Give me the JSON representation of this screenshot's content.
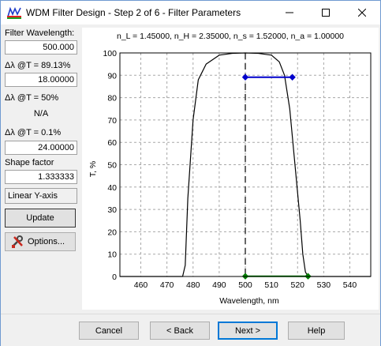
{
  "window": {
    "title": "WDM Filter Design - Step 2 of 6 - Filter Parameters"
  },
  "left_panel": {
    "filter_wavelength_label": "Filter Wavelength:",
    "filter_wavelength_value": "500.000",
    "dl_8913_label": "Δλ @T = 89.13%",
    "dl_8913_value": "18.00000",
    "dl_50_label": "Δλ @T = 50%",
    "dl_50_value": "N/A",
    "dl_01_label": "Δλ @T = 0.1%",
    "dl_01_value": "24.00000",
    "shape_factor_label": "Shape factor",
    "shape_factor_value": "1.333333",
    "y_axis_mode": "Linear Y-axis",
    "update_label": "Update",
    "options_label": "Options..."
  },
  "buttons": {
    "cancel": "Cancel",
    "back": "< Back",
    "next": "Next >",
    "help": "Help"
  },
  "chart_data": {
    "type": "line",
    "title": "n_L = 1.45000, n_H = 2.35000, n_s = 1.52000, n_a = 1.00000",
    "xlabel": "Wavelength, nm",
    "ylabel": "T, %",
    "xlim": [
      452,
      548
    ],
    "ylim": [
      0,
      100
    ],
    "xticks": [
      460,
      470,
      480,
      490,
      500,
      510,
      520,
      530,
      540
    ],
    "yticks": [
      0,
      10,
      20,
      30,
      40,
      50,
      60,
      70,
      80,
      90,
      100
    ],
    "grid": true,
    "series": [
      {
        "color": "#000000",
        "x": [
          452,
          470,
          476,
          477,
          478,
          480,
          482,
          485,
          490,
          495,
          500,
          505,
          510,
          513,
          515,
          517,
          519,
          521,
          522,
          523,
          524,
          548
        ],
        "values": [
          0,
          0,
          0,
          5,
          35,
          70,
          88,
          95,
          99,
          99.8,
          100,
          99.8,
          99,
          96,
          90,
          75,
          50,
          25,
          10,
          2,
          0,
          0
        ]
      },
      {
        "color": "#0000cc",
        "x": [
          500,
          518
        ],
        "values": [
          89.13,
          89.13
        ]
      },
      {
        "color": "#008000",
        "x": [
          500,
          524
        ],
        "values": [
          0.1,
          0.1
        ]
      }
    ],
    "center_line_x": 500
  }
}
